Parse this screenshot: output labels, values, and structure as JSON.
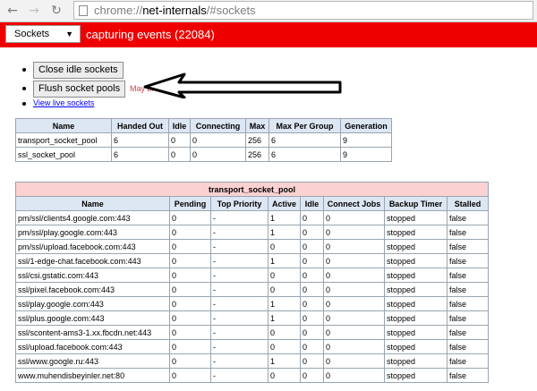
{
  "browser": {
    "url_host": "chrome://net-internals",
    "url_dim": "/#sockets"
  },
  "header": {
    "view_select": "Sockets",
    "status": "capturing events (22084)",
    "color": "#ee0000"
  },
  "actions": {
    "close_idle": "Close idle sockets",
    "flush": "Flush socket pools",
    "warning": "May break pages with active connections",
    "view_live": "View live sockets"
  },
  "pool_table": {
    "headers": [
      "Name",
      "Handed Out",
      "Idle",
      "Connecting",
      "Max",
      "Max Per Group",
      "Generation"
    ],
    "rows": [
      [
        "transport_socket_pool",
        "6",
        "0",
        "0",
        "256",
        "6",
        "9"
      ],
      [
        "ssl_socket_pool",
        "6",
        "0",
        "0",
        "256",
        "6",
        "9"
      ]
    ]
  },
  "group_table": {
    "caption": "transport_socket_pool",
    "headers": [
      "Name",
      "Pending",
      "Top Priority",
      "Active",
      "Idle",
      "Connect Jobs",
      "Backup Timer",
      "Stalled"
    ],
    "rows": [
      [
        "pm/ssl/clients4.google.com:443",
        "0",
        "-",
        "1",
        "0",
        "0",
        "stopped",
        "false"
      ],
      [
        "pm/ssl/play.google.com:443",
        "0",
        "-",
        "1",
        "0",
        "0",
        "stopped",
        "false"
      ],
      [
        "pm/ssl/upload.facebook.com:443",
        "0",
        "-",
        "0",
        "0",
        "0",
        "stopped",
        "false"
      ],
      [
        "ssl/1-edge-chat.facebook.com:443",
        "0",
        "-",
        "1",
        "0",
        "0",
        "stopped",
        "false"
      ],
      [
        "ssl/csi.gstatic.com:443",
        "0",
        "-",
        "0",
        "0",
        "0",
        "stopped",
        "false"
      ],
      [
        "ssl/pixel.facebook.com:443",
        "0",
        "-",
        "0",
        "0",
        "0",
        "stopped",
        "false"
      ],
      [
        "ssl/play.google.com:443",
        "0",
        "-",
        "1",
        "0",
        "0",
        "stopped",
        "false"
      ],
      [
        "ssl/plus.google.com:443",
        "0",
        "-",
        "1",
        "0",
        "0",
        "stopped",
        "false"
      ],
      [
        "ssl/scontent-ams3-1.xx.fbcdn.net:443",
        "0",
        "-",
        "0",
        "0",
        "0",
        "stopped",
        "false"
      ],
      [
        "ssl/upload.facebook.com:443",
        "0",
        "-",
        "0",
        "0",
        "0",
        "stopped",
        "false"
      ],
      [
        "ssl/www.google.ru:443",
        "0",
        "-",
        "1",
        "0",
        "0",
        "stopped",
        "false"
      ],
      [
        "www.muhendisbeyinler.net:80",
        "0",
        "-",
        "0",
        "0",
        "0",
        "stopped",
        "false"
      ]
    ]
  }
}
